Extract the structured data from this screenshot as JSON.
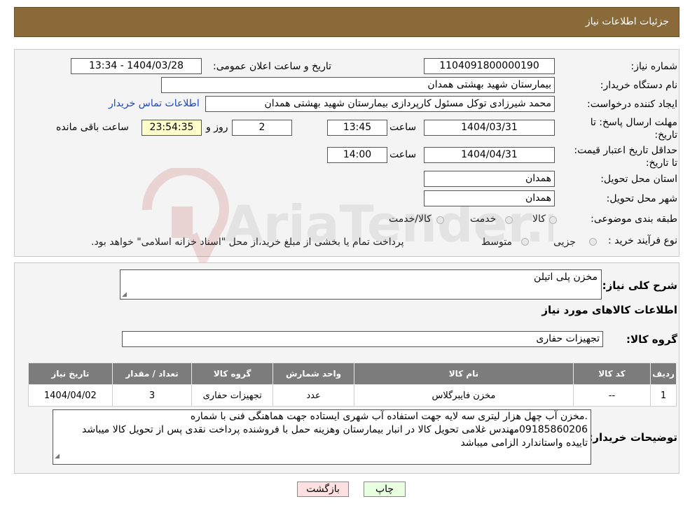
{
  "header": {
    "title": "جزئیات اطلاعات نیاز"
  },
  "form": {
    "need_number_label": "شماره نیاز:",
    "need_number": "1104091800000190",
    "announce_label": "تاریخ و ساعت اعلان عمومی:",
    "announce_value": "1404/03/28 - 13:34",
    "buyer_org_label": "نام دستگاه خریدار:",
    "buyer_org": "بیمارستان شهید بهشتی همدان",
    "creator_label": "ایجاد کننده درخواست:",
    "creator": "محمد شیرزادی توکل مسئول کارپردازی بیمارستان شهید بهشتی همدان",
    "contact_link": "اطلاعات تماس خریدار",
    "reply_deadline_label": "مهلت ارسال پاسخ: تا تاریخ:",
    "reply_date": "1404/03/31",
    "time_label": "ساعت",
    "reply_time": "13:45",
    "days_value": "2",
    "days_label": "روز و",
    "remaining_time": "23:54:35",
    "remaining_label": "ساعت باقی مانده",
    "validity_label": "حداقل تاریخ اعتبار قیمت: تا تاریخ:",
    "validity_date": "1404/04/31",
    "validity_time": "14:00",
    "province_label": "استان محل تحویل:",
    "province": "همدان",
    "city_label": "شهر محل تحویل:",
    "city": "همدان",
    "category_label": "طبقه بندی موضوعی:",
    "category_options": [
      "کالا",
      "خدمت",
      "کالا/خدمت"
    ],
    "process_label": "نوع فرآیند خرید :",
    "process_options": [
      "جزیی",
      "متوسط"
    ],
    "process_note": "پرداخت تمام یا بخشی از مبلغ خرید،از محل \"اسناد خزانه اسلامی\" خواهد بود."
  },
  "summary": {
    "need_desc_label": "شرح کلی نیاز:",
    "need_desc": "مخزن پلی اتیلن",
    "goods_info_title": "اطلاعات کالاهای مورد نیاز",
    "goods_group_label": "گروه کالا:",
    "goods_group": "تجهیزات حفاری"
  },
  "table": {
    "headers": [
      "ردیف",
      "کد کالا",
      "نام کالا",
      "واحد شمارش",
      "گروه کالا",
      "تعداد / مقدار",
      "تاریخ نیاز"
    ],
    "rows": [
      [
        "1",
        "--",
        "مخزن فایبرگلاس",
        "عدد",
        "تجهیزات حفاری",
        "3",
        "1404/04/02"
      ]
    ]
  },
  "buyer_notes": {
    "label": "توضیحات خریدار:",
    "line1": ".مخزن آب چهل هزار لیتری سه لایه جهت استفاده آب شهری ایستاده جهت هماهنگی فنی با شماره",
    "line2": "09185860206مهندس غلامی تحویل کالا در انبار بیمارستان وهزینه حمل با فروشنده پرداخت نقدی پس از تحویل کالا میباشد",
    "line3": "تاییده واستاندارد الزامی میباشد"
  },
  "buttons": {
    "print": "چاپ",
    "back": "بازگشت"
  },
  "watermark": {
    "text": "AriaTender.neT"
  },
  "colors": {
    "header_bg": "#8b6a3a",
    "table_header_bg": "#7c7c7c",
    "link": "#1a45c8",
    "back_btn": "#ffe0e0",
    "print_btn": "#e8ffe0"
  }
}
